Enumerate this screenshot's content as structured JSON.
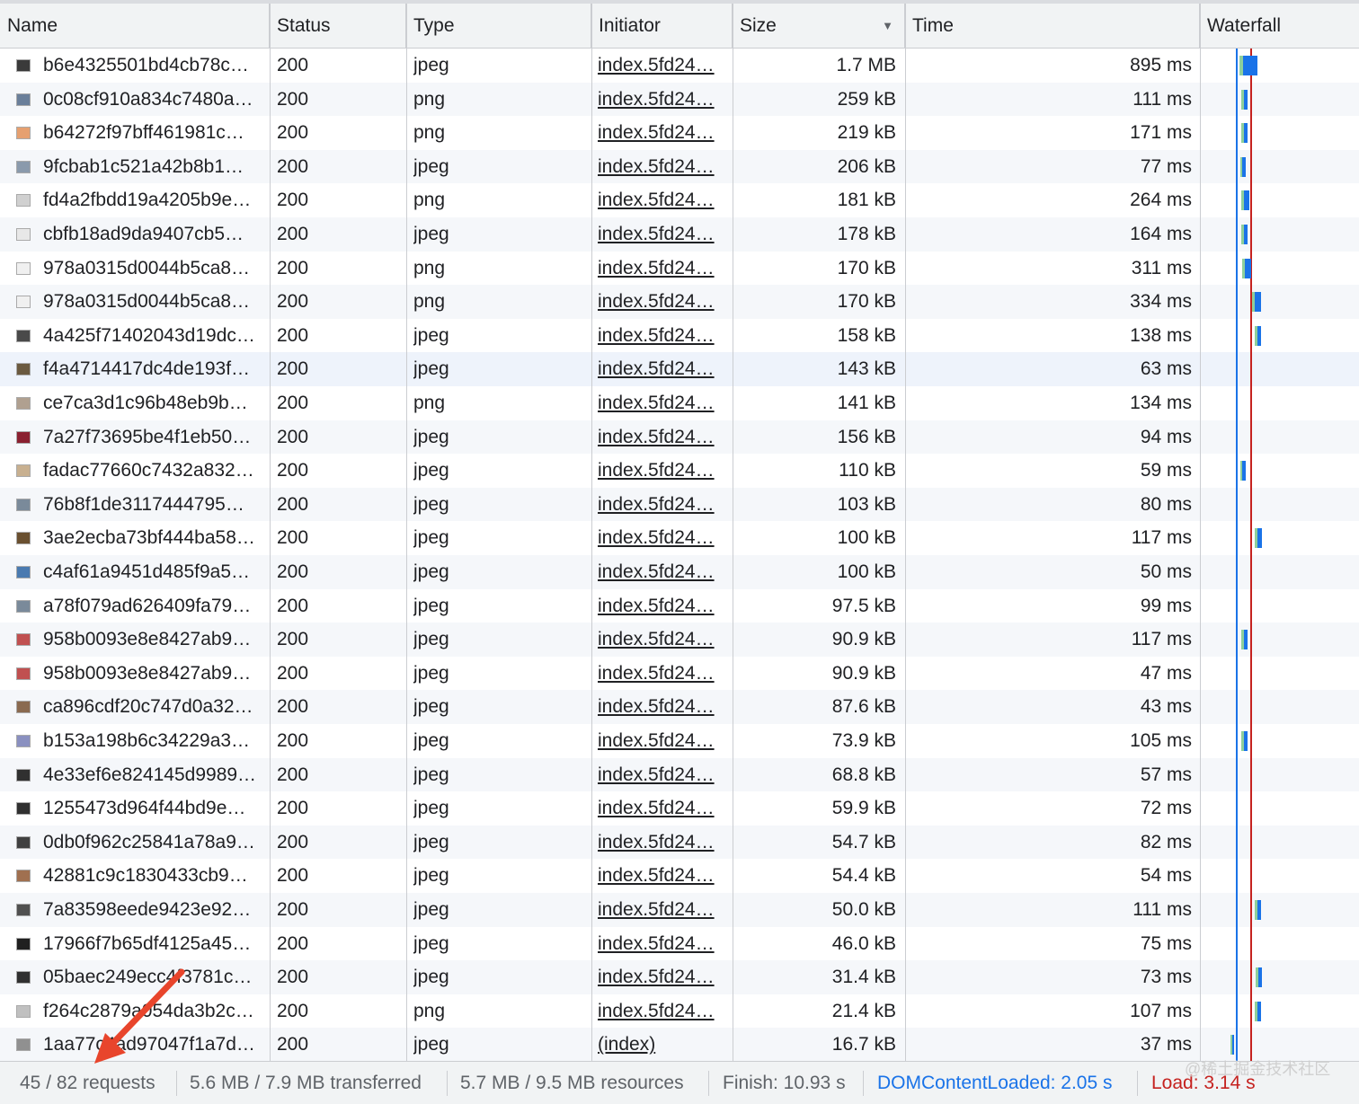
{
  "columns": {
    "name": "Name",
    "status": "Status",
    "type": "Type",
    "initiator": "Initiator",
    "size": "Size",
    "time": "Time",
    "waterfall": "Waterfall",
    "sort_icon": "triangle-down-icon"
  },
  "rows": [
    {
      "name": "b6e4325501bd4cb78c…",
      "status": "200",
      "type": "jpeg",
      "initiator": "index.5fd24…",
      "size": "1.7 MB",
      "time": "895 ms"
    },
    {
      "name": "0c08cf910a834c7480a…",
      "status": "200",
      "type": "png",
      "initiator": "index.5fd24…",
      "size": "259 kB",
      "time": "111 ms"
    },
    {
      "name": "b64272f97bff461981c…",
      "status": "200",
      "type": "png",
      "initiator": "index.5fd24…",
      "size": "219 kB",
      "time": "171 ms"
    },
    {
      "name": "9fcbab1c521a42b8b1…",
      "status": "200",
      "type": "jpeg",
      "initiator": "index.5fd24…",
      "size": "206 kB",
      "time": "77 ms"
    },
    {
      "name": "fd4a2fbdd19a4205b9e…",
      "status": "200",
      "type": "png",
      "initiator": "index.5fd24…",
      "size": "181 kB",
      "time": "264 ms"
    },
    {
      "name": "cbfb18ad9da9407cb5…",
      "status": "200",
      "type": "jpeg",
      "initiator": "index.5fd24…",
      "size": "178 kB",
      "time": "164 ms"
    },
    {
      "name": "978a0315d0044b5ca8…",
      "status": "200",
      "type": "png",
      "initiator": "index.5fd24…",
      "size": "170 kB",
      "time": "311 ms"
    },
    {
      "name": "978a0315d0044b5ca8…",
      "status": "200",
      "type": "png",
      "initiator": "index.5fd24…",
      "size": "170 kB",
      "time": "334 ms"
    },
    {
      "name": "4a425f71402043d19dc…",
      "status": "200",
      "type": "jpeg",
      "initiator": "index.5fd24…",
      "size": "158 kB",
      "time": "138 ms"
    },
    {
      "name": "f4a4714417dc4de193f…",
      "status": "200",
      "type": "jpeg",
      "initiator": "index.5fd24…",
      "size": "143 kB",
      "time": "63 ms"
    },
    {
      "name": "ce7ca3d1c96b48eb9b…",
      "status": "200",
      "type": "png",
      "initiator": "index.5fd24…",
      "size": "141 kB",
      "time": "134 ms"
    },
    {
      "name": "7a27f73695be4f1eb50…",
      "status": "200",
      "type": "jpeg",
      "initiator": "index.5fd24…",
      "size": "156 kB",
      "time": "94 ms"
    },
    {
      "name": "fadac77660c7432a832…",
      "status": "200",
      "type": "jpeg",
      "initiator": "index.5fd24…",
      "size": "110 kB",
      "time": "59 ms"
    },
    {
      "name": "76b8f1de3117444795…",
      "status": "200",
      "type": "jpeg",
      "initiator": "index.5fd24…",
      "size": "103 kB",
      "time": "80 ms"
    },
    {
      "name": "3ae2ecba73bf444ba58…",
      "status": "200",
      "type": "jpeg",
      "initiator": "index.5fd24…",
      "size": "100 kB",
      "time": "117 ms"
    },
    {
      "name": "c4af61a9451d485f9a5…",
      "status": "200",
      "type": "jpeg",
      "initiator": "index.5fd24…",
      "size": "100 kB",
      "time": "50 ms"
    },
    {
      "name": "a78f079ad626409fa79…",
      "status": "200",
      "type": "jpeg",
      "initiator": "index.5fd24…",
      "size": "97.5 kB",
      "time": "99 ms"
    },
    {
      "name": "958b0093e8e8427ab9…",
      "status": "200",
      "type": "jpeg",
      "initiator": "index.5fd24…",
      "size": "90.9 kB",
      "time": "117 ms"
    },
    {
      "name": "958b0093e8e8427ab9…",
      "status": "200",
      "type": "jpeg",
      "initiator": "index.5fd24…",
      "size": "90.9 kB",
      "time": "47 ms"
    },
    {
      "name": "ca896cdf20c747d0a32…",
      "status": "200",
      "type": "jpeg",
      "initiator": "index.5fd24…",
      "size": "87.6 kB",
      "time": "43 ms"
    },
    {
      "name": "b153a198b6c34229a3…",
      "status": "200",
      "type": "jpeg",
      "initiator": "index.5fd24…",
      "size": "73.9 kB",
      "time": "105 ms"
    },
    {
      "name": "4e33ef6e824145d9989…",
      "status": "200",
      "type": "jpeg",
      "initiator": "index.5fd24…",
      "size": "68.8 kB",
      "time": "57 ms"
    },
    {
      "name": "1255473d964f44bd9e…",
      "status": "200",
      "type": "jpeg",
      "initiator": "index.5fd24…",
      "size": "59.9 kB",
      "time": "72 ms"
    },
    {
      "name": "0db0f962c25841a78a9…",
      "status": "200",
      "type": "jpeg",
      "initiator": "index.5fd24…",
      "size": "54.7 kB",
      "time": "82 ms"
    },
    {
      "name": "42881c9c1830433cb9…",
      "status": "200",
      "type": "jpeg",
      "initiator": "index.5fd24…",
      "size": "54.4 kB",
      "time": "54 ms"
    },
    {
      "name": "7a83598eede9423e92…",
      "status": "200",
      "type": "jpeg",
      "initiator": "index.5fd24…",
      "size": "50.0 kB",
      "time": "111 ms"
    },
    {
      "name": "17966f7b65df4125a45…",
      "status": "200",
      "type": "jpeg",
      "initiator": "index.5fd24…",
      "size": "46.0 kB",
      "time": "75 ms"
    },
    {
      "name": "05baec249ecc4f3781c…",
      "status": "200",
      "type": "jpeg",
      "initiator": "index.5fd24…",
      "size": "31.4 kB",
      "time": "73 ms"
    },
    {
      "name": "f264c2879a054da3b2c…",
      "status": "200",
      "type": "png",
      "initiator": "index.5fd24…",
      "size": "21.4 kB",
      "time": "107 ms"
    },
    {
      "name": "1aa77c4ad97047f1a7d…",
      "status": "200",
      "type": "jpeg",
      "initiator": "(index)",
      "size": "16.7 kB",
      "time": "37 ms"
    }
  ],
  "footer": {
    "requests": "45 / 82 requests",
    "transferred": "5.6 MB / 7.9 MB transferred",
    "resources": "5.7 MB / 9.5 MB resources",
    "finish": "Finish: 10.93 s",
    "dom_content_loaded": "DOMContentLoaded: 2.05 s",
    "load": "Load: 3.14 s"
  },
  "watermark": "@稀土掘金技术社区",
  "colors": {
    "dom_content_loaded": "#1a73e8",
    "load": "#c5221f",
    "annotation_arrow": "#e8452c",
    "waiting_bar": "#8ecf9b",
    "download_bar": "#1a73e8"
  }
}
